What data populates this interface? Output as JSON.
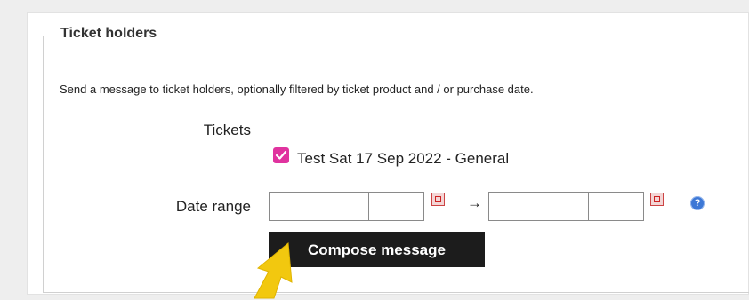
{
  "section": {
    "legend": "Ticket holders",
    "description": "Send a message to ticket holders, optionally filtered by ticket product and / or purchase date."
  },
  "tickets": {
    "label": "Tickets",
    "options": [
      {
        "label": "Test Sat 17 Sep 2022 - General",
        "checked": true
      }
    ]
  },
  "date_range": {
    "label": "Date range",
    "separator": "→",
    "from_date": "",
    "from_time": "",
    "to_date": "",
    "to_time": ""
  },
  "help": {
    "glyph": "?"
  },
  "compose_button": {
    "label": "Compose message"
  },
  "colors": {
    "checkbox": "#e0339f",
    "button_bg": "#1c1c1c",
    "help_icon": "#3d78d6",
    "cursor_arrow": "#f2c80f"
  },
  "icons": [
    "calendar-icon",
    "help-icon",
    "check-icon",
    "pointer-arrow"
  ]
}
